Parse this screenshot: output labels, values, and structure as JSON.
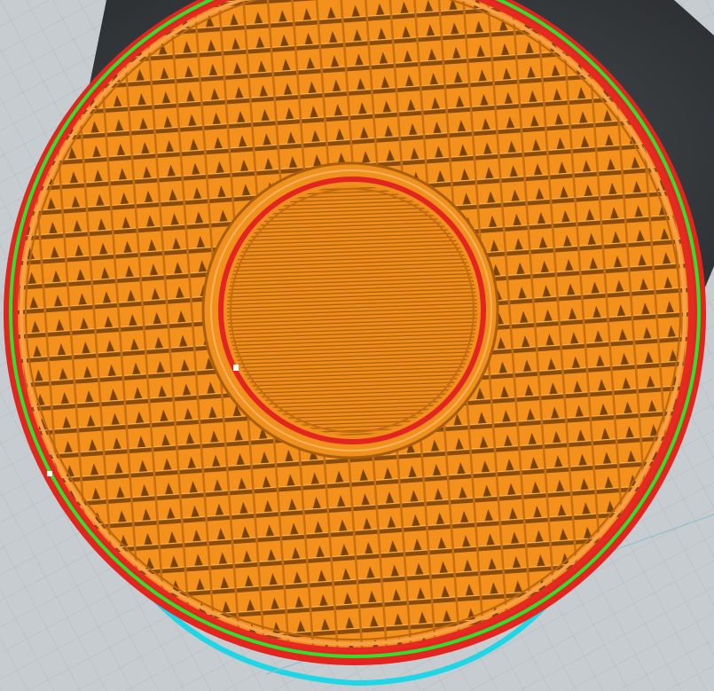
{
  "app": {
    "view": "slicer-layer-preview"
  },
  "colors": {
    "build_plate": "#c7ccd0",
    "grid_line": "#b3b9be",
    "dark_background": "#3d4043",
    "wall_outer": "#e3241f",
    "wall_outer_dark": "#b8150f",
    "infill": "#f4901c",
    "infill_dark": "#7a4308",
    "skirt": "#2fe02f",
    "travel_path": "#1fd6e6"
  },
  "preview": {
    "model_shape": "cylinder",
    "infill_pattern": "grid",
    "center_top_layer": "lines",
    "legend": []
  }
}
